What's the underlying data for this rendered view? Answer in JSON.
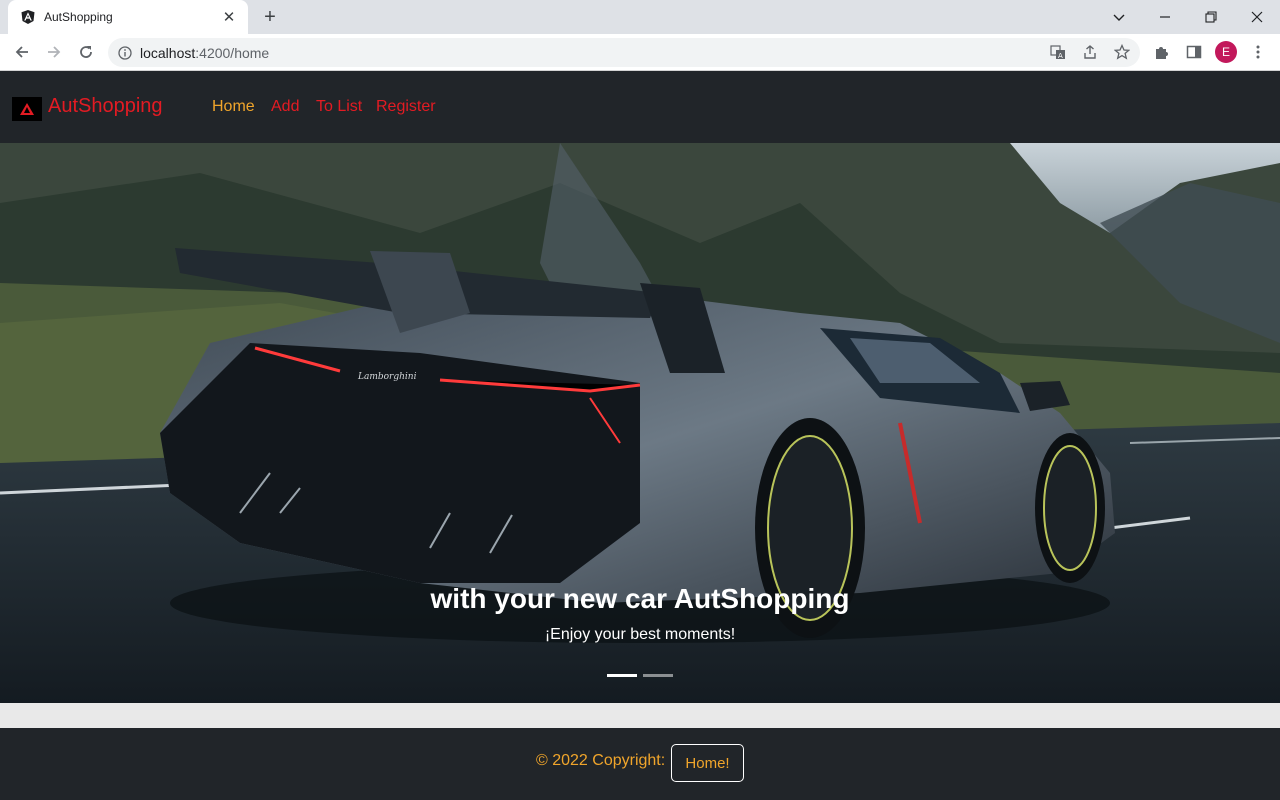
{
  "browser": {
    "tab_title": "AutShopping",
    "url_host": "localhost",
    "url_rest": ":4200/home",
    "profile_initial": "E"
  },
  "navbar": {
    "brand": "AutShopping",
    "links": [
      {
        "label": "Home",
        "active": true
      },
      {
        "label": "Add",
        "active": false
      },
      {
        "label": "To List",
        "active": false
      },
      {
        "label": "Register",
        "active": false
      }
    ]
  },
  "carousel": {
    "caption_title": "with your new car AutShopping",
    "caption_subtitle": "¡Enjoy your best moments!",
    "active_slide": 0,
    "slide_count": 2
  },
  "footer": {
    "copyright": "© 2022 Copyright:",
    "button_label": "Home!"
  },
  "colors": {
    "navbar_bg": "#212529",
    "brand_red": "#e31b23",
    "accent_orange": "#f0a52b"
  }
}
